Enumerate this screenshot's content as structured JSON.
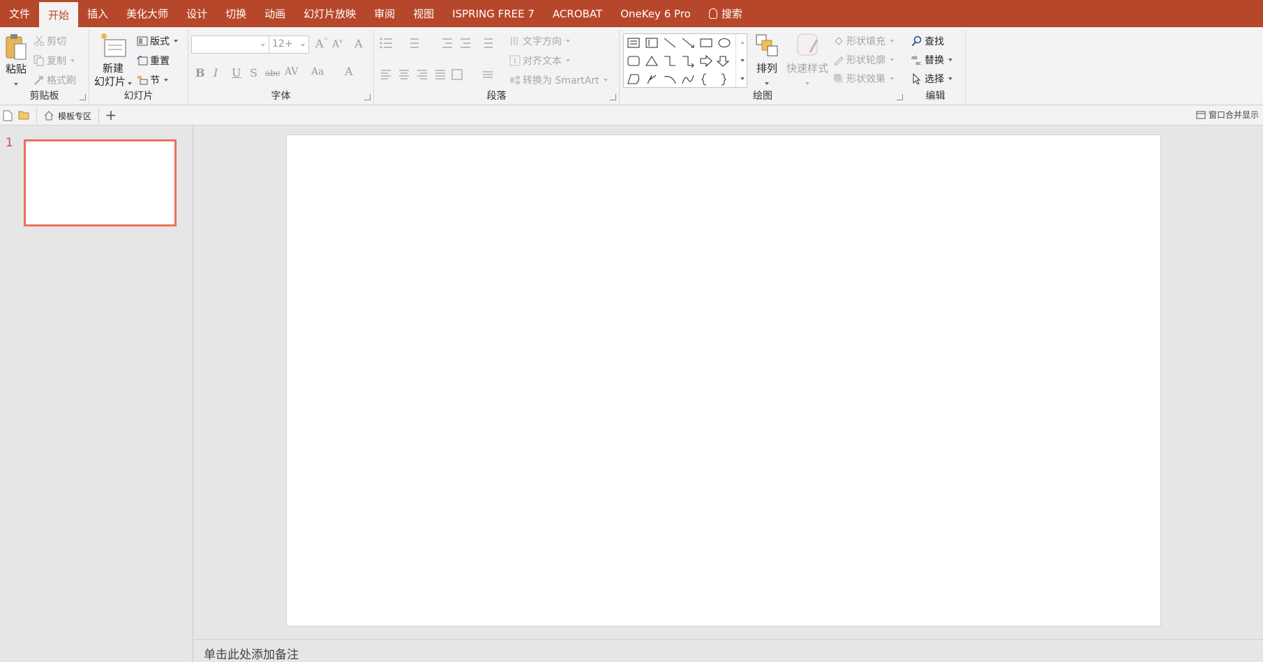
{
  "menubar": {
    "tabs": [
      "文件",
      "开始",
      "插入",
      "美化大师",
      "设计",
      "切换",
      "动画",
      "幻灯片放映",
      "审阅",
      "视图",
      "ISPRING FREE 7",
      "ACROBAT",
      "OneKey 6 Pro"
    ],
    "active_tab": "开始",
    "search_label": "搜索",
    "accent_color": "#b7472a"
  },
  "ribbon": {
    "clipboard": {
      "paste": "粘贴",
      "cut": "剪切",
      "copy": "复制",
      "format_painter": "格式刷",
      "label": "剪贴板"
    },
    "slides": {
      "new_slide_line1": "新建",
      "new_slide_line2": "幻灯片",
      "layout": "版式",
      "reset": "重置",
      "section": "节",
      "label": "幻灯片"
    },
    "font": {
      "font_name": "",
      "font_size": "12+",
      "label": "字体"
    },
    "paragraph": {
      "text_direction": "文字方向",
      "align_text": "对齐文本",
      "convert_smartart": "转换为 SmartArt",
      "label": "段落"
    },
    "drawing": {
      "arrange": "排列",
      "quick_styles": "快速样式",
      "shape_fill": "形状填充",
      "shape_outline": "形状轮廓",
      "shape_effects": "形状效果",
      "label": "绘图"
    },
    "editing": {
      "find": "查找",
      "replace": "替换",
      "select": "选择",
      "label": "编辑"
    }
  },
  "quickbar": {
    "template_zone": "模板专区",
    "merge_windows": "窗口合并显示"
  },
  "thumbnails": {
    "slide_number": "1",
    "selected_border_color": "#e8735a"
  },
  "notes": {
    "placeholder": "单击此处添加备注"
  }
}
